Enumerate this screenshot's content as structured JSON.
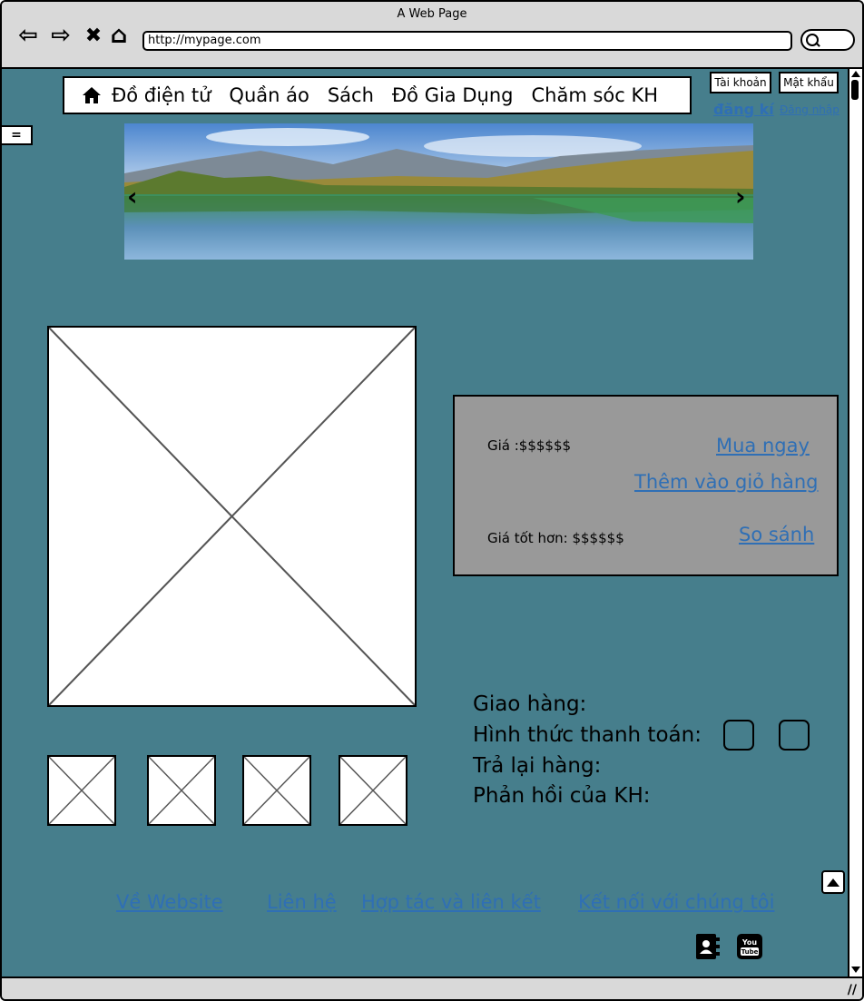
{
  "window": {
    "title": "A Web Page",
    "url": "http://mypage.com"
  },
  "nav": {
    "back": "⇦",
    "forward": "⇨",
    "stop": "✖",
    "home": "⌂"
  },
  "menu": {
    "items": [
      "Đồ điện tử",
      "Quần áo",
      "Sách",
      "Đồ Gia Dụng",
      "Chăm sóc KH"
    ]
  },
  "account": {
    "username_label": "Tài khoản",
    "password_label": "Mật khẩu",
    "register_link": "đăng kí",
    "login_link": "Đăng nhập"
  },
  "sidemenu": {
    "label": "="
  },
  "banner": {
    "prev": "‹",
    "next": "›"
  },
  "price": {
    "price_label": "Giá :$$$$$$",
    "better_price_label": "Giá tốt hơn: $$$$$$",
    "buy_now": "Mua  ngay ",
    "add_to_cart": "Thêm vào giỏ hàng",
    "compare": "So sánh"
  },
  "info": {
    "shipping": "Giao hàng:",
    "payment": "Hình thức thanh toán:",
    "returns": "Trả lại hàng:",
    "feedback": "Phản hồi của KH:"
  },
  "footer": {
    "about": "Về Website",
    "contact": "Liên hệ",
    "partners": "Hợp tác và liên kết",
    "connect": "Kết nối với chúng tôi"
  },
  "icons": {
    "home": "home-icon",
    "contacts": "address-book-icon",
    "youtube": "youtube-icon",
    "scroll_top": "arrow-up-icon"
  },
  "colors": {
    "page_bg": "#467e8c",
    "link": "#2f6fb5",
    "panel": "#999999",
    "chrome": "#d9d9d9"
  }
}
